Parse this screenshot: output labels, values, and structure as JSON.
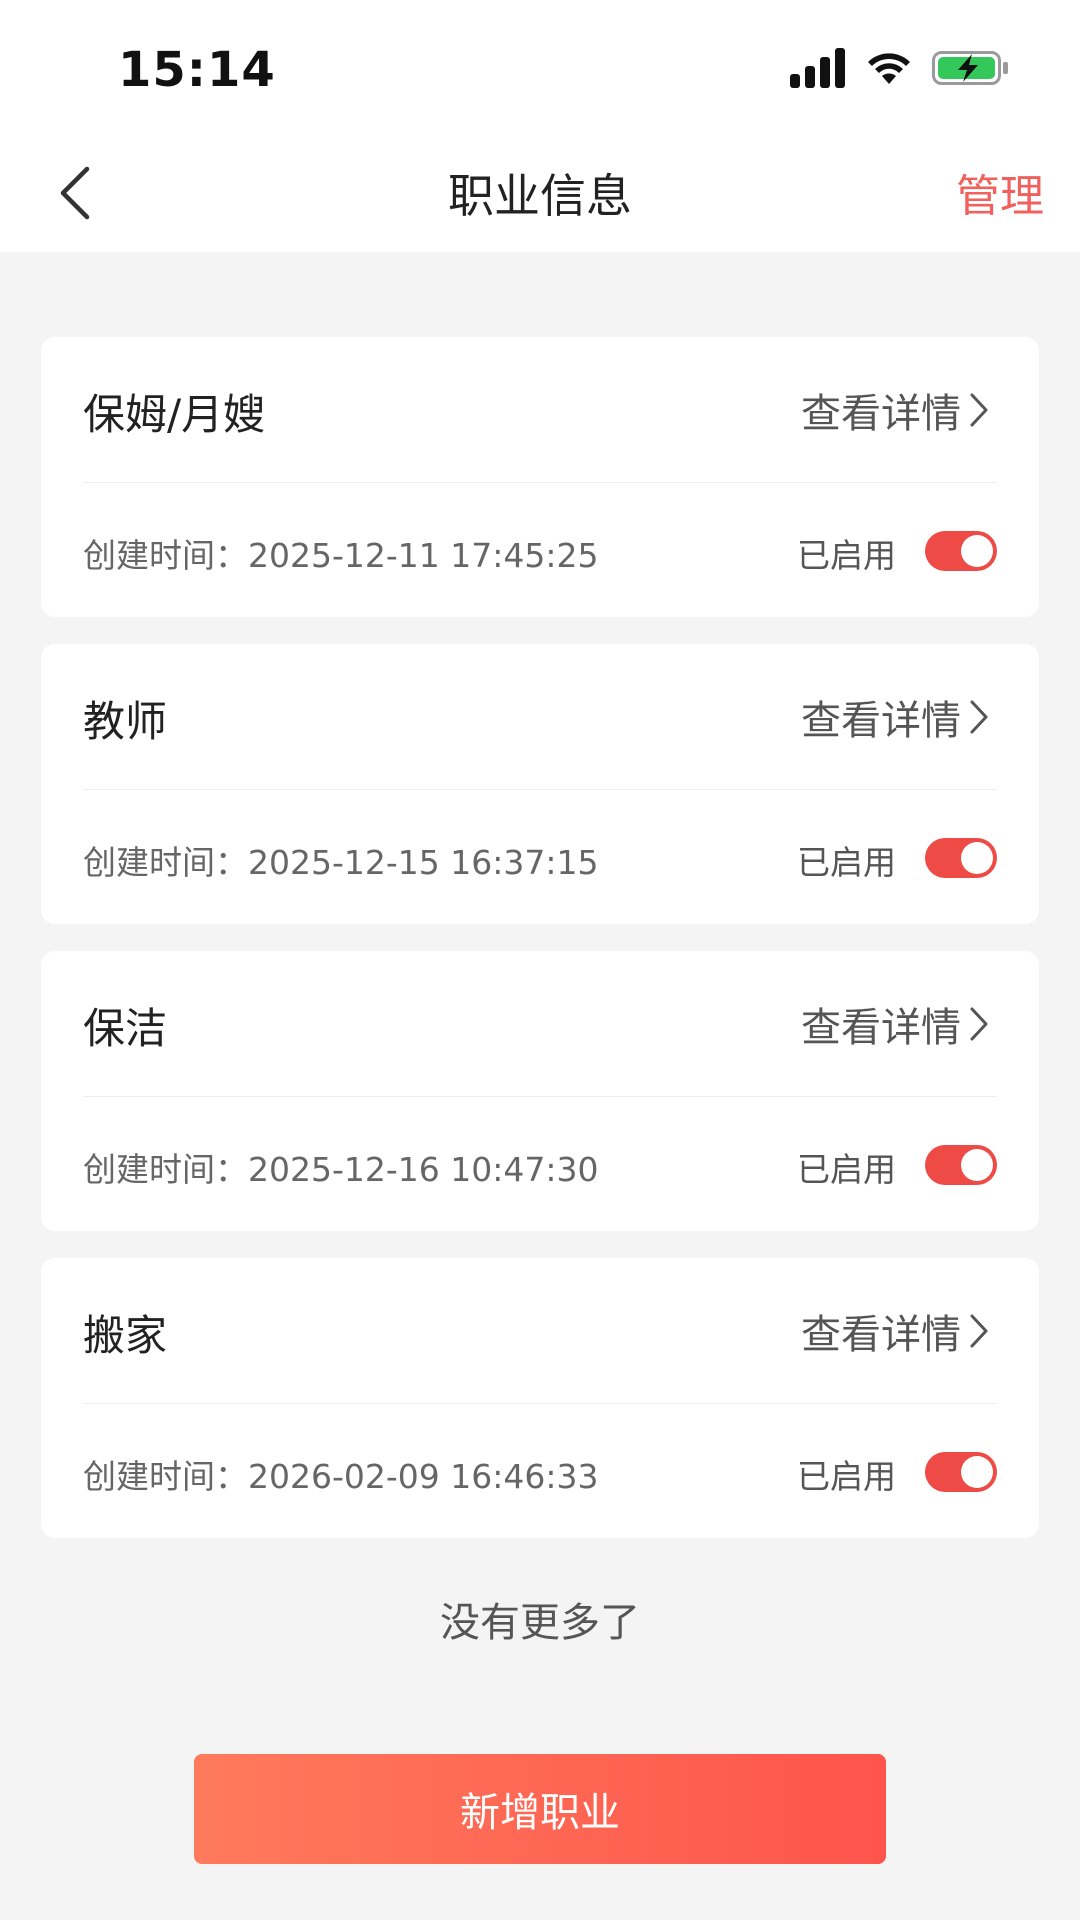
{
  "status_bar": {
    "time": "15:14"
  },
  "nav": {
    "title": "职业信息",
    "manage_label": "管理"
  },
  "cards": [
    {
      "name": "保姆/月嫂",
      "detail_label": "查看详情",
      "created_at": "创建时间：2025-12-11 17:45:25",
      "status": "已启用"
    },
    {
      "name": "教师",
      "detail_label": "查看详情",
      "created_at": "创建时间：2025-12-15 16:37:15",
      "status": "已启用"
    },
    {
      "name": "保洁",
      "detail_label": "查看详情",
      "created_at": "创建时间：2025-12-16 10:47:30",
      "status": "已启用"
    },
    {
      "name": "搬家",
      "detail_label": "查看详情",
      "created_at": "创建时间：2026-02-09 16:46:33",
      "status": "已启用"
    }
  ],
  "footer": {
    "no_more": "没有更多了",
    "add_button": "新增职业"
  },
  "colors": {
    "accent": "#f0605c",
    "toggle_on": "#ee4b46",
    "button_gradient_start": "#ff7a5c",
    "button_gradient_end": "#fe544b"
  }
}
